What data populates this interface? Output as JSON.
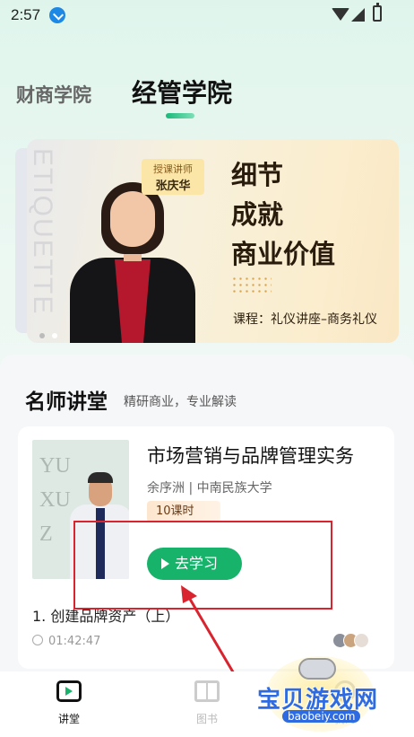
{
  "status_bar": {
    "time": "2:57"
  },
  "tabs": [
    {
      "label": "财商学院",
      "active": false
    },
    {
      "label": "经管学院",
      "active": true
    }
  ],
  "banner": {
    "vertical_text": "ETIQUETTE",
    "instructor_caption": "授课讲师",
    "instructor_name": "张庆华",
    "headline": [
      "细节",
      "成就",
      "商业价值"
    ],
    "course_label": "课程：礼仪讲座–商务礼仪",
    "pages": 2,
    "current_page": 2
  },
  "section": {
    "title": "名师讲堂",
    "subtitle": "精研商业，专业解读"
  },
  "course_card": {
    "thumb_letters": [
      "YU",
      "XU",
      "Z"
    ],
    "title": "市场营销与品牌管理实务",
    "meta": "余序洲 | 中南民族大学",
    "lessons": "10课时",
    "cta": "去学习",
    "chapter": "1. 创建品牌资产（上）",
    "duration": "01:42:47"
  },
  "bottom_nav": [
    {
      "label": "讲堂",
      "icon": "tv-icon",
      "active": true
    },
    {
      "label": "图书",
      "icon": "book-icon",
      "active": false
    },
    {
      "label": "我的",
      "icon": "user-icon",
      "active": false
    }
  ],
  "watermark": {
    "text": "宝贝游戏网",
    "url": "baobeiy.com"
  },
  "colors": {
    "accent": "#18b36b",
    "annotation": "#d9232e",
    "watermark": "#2f6be0"
  }
}
